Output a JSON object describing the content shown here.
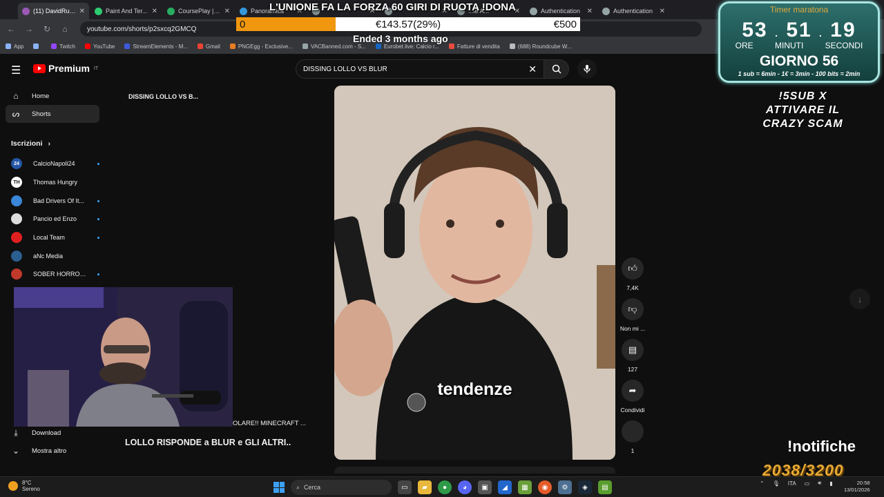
{
  "browser": {
    "tabs": [
      {
        "label": "(11) DavidRub...",
        "color": "#9b59b6",
        "active": true
      },
      {
        "label": "Paint And Ter...",
        "color": "#2ecc71",
        "active": false
      },
      {
        "label": "CoursePlay | M...",
        "color": "#27ae60",
        "active": false
      },
      {
        "label": "Panoramica",
        "color": "#3498db",
        "active": false
      },
      {
        "label": "",
        "color": "#7f8c8d",
        "active": false
      },
      {
        "label": "",
        "color": "#7f8c8d",
        "active": false
      },
      {
        "label": "...le A...",
        "color": "#7f8c8d",
        "active": false
      },
      {
        "label": "Authentication",
        "color": "#95a5a6",
        "active": false
      },
      {
        "label": "Authentication",
        "color": "#95a5a6",
        "active": false
      }
    ],
    "url": "youtube.com/shorts/p2sxcq2GMCQ",
    "bookmarks": [
      {
        "label": "App",
        "color": "#8ab4f8"
      },
      {
        "label": "",
        "color": "#8ab4f8"
      },
      {
        "label": "Twitch",
        "color": "#9146ff"
      },
      {
        "label": "YouTube",
        "color": "#ff0000"
      },
      {
        "label": "StreamElements - M...",
        "color": "#3b5bdb"
      },
      {
        "label": "Gmail",
        "color": "#ea4335"
      },
      {
        "label": "PNGEgg - Exclusive...",
        "color": "#e67e22"
      },
      {
        "label": "VACBanned.com - S...",
        "color": "#95a5a6"
      },
      {
        "label": "Eurobet.live: Calcio r...",
        "color": "#1565c0"
      },
      {
        "label": "Fatture di vendita",
        "color": "#e74c3c"
      },
      {
        "label": "(688) Roundcube W...",
        "color": "#bbb"
      }
    ]
  },
  "youtube": {
    "logo_text": "Premium",
    "logo_region": "IT",
    "search_query": "DISSING LOLLO VS BLUR",
    "sidebar": {
      "home": "Home",
      "shorts": "Shorts",
      "subscriptions_title": "Iscrizioni",
      "download": "Download",
      "show_more": "Mostra altro"
    },
    "subscriptions": [
      {
        "name": "CalcioNapoli24",
        "avatar_color": "#2457a6",
        "avatar_text": "24",
        "live": true
      },
      {
        "name": "Thomas Hungry",
        "avatar_color": "#ffffff",
        "avatar_text": "TH",
        "live": false
      },
      {
        "name": "Bad Drivers Of It...",
        "avatar_color": "#3a86d8",
        "avatar_text": "",
        "live": true
      },
      {
        "name": "Pancio ed Enzo",
        "avatar_color": "#dddddd",
        "avatar_text": "",
        "live": true
      },
      {
        "name": "Local Team",
        "avatar_color": "#e02020",
        "avatar_text": "",
        "live": true
      },
      {
        "name": "aNc Media",
        "avatar_color": "#2a5f8f",
        "avatar_text": "",
        "live": false
      },
      {
        "name": "SOBER HORROR ...",
        "avatar_color": "#c0392b",
        "avatar_text": "",
        "live": true
      }
    ],
    "mid_title": "DISSING LOLLO VS B...",
    "mid_line": "OLARE!! MINECRAFT ...",
    "mid_bold": "LOLLO RISPONDE a BLUR e GLI ALTRI..",
    "video_caption": "tendenze",
    "actions": {
      "likes": "7,4K",
      "dislike_label": "Non mi ...",
      "comments": "127",
      "share_label": "Condividi",
      "remix_count": "1"
    }
  },
  "overlay": {
    "banner_title": "L'UNIONE FA LA FORZA 60 GIRI DI RUOTA !DONA",
    "goal_start": "0",
    "goal_current": "€143.57(29%)",
    "goal_end": "€500",
    "goal_fraction": 0.29,
    "ended": "Ended 3 months ago",
    "timer_title": "Timer maratona",
    "hours": "53",
    "minutes": "51",
    "seconds": "19",
    "unit_hours": "ORE",
    "unit_minutes": "MINUTI",
    "unit_seconds": "SECONDI",
    "day": "GIORNO 56",
    "rules": "1 sub = 6min - 1€ = 3min - 100 bits = 2min",
    "sub_text": "!5SUB X ATTIVARE IL CRAZY SCAM",
    "notifiche": "!notifiche",
    "sub_goal": "2038/3200"
  },
  "taskbar": {
    "temperature": "8°C",
    "weather": "Sereno",
    "search": "Cerca",
    "language": "ITA",
    "time": "20:58",
    "date": "13/01/2026"
  }
}
